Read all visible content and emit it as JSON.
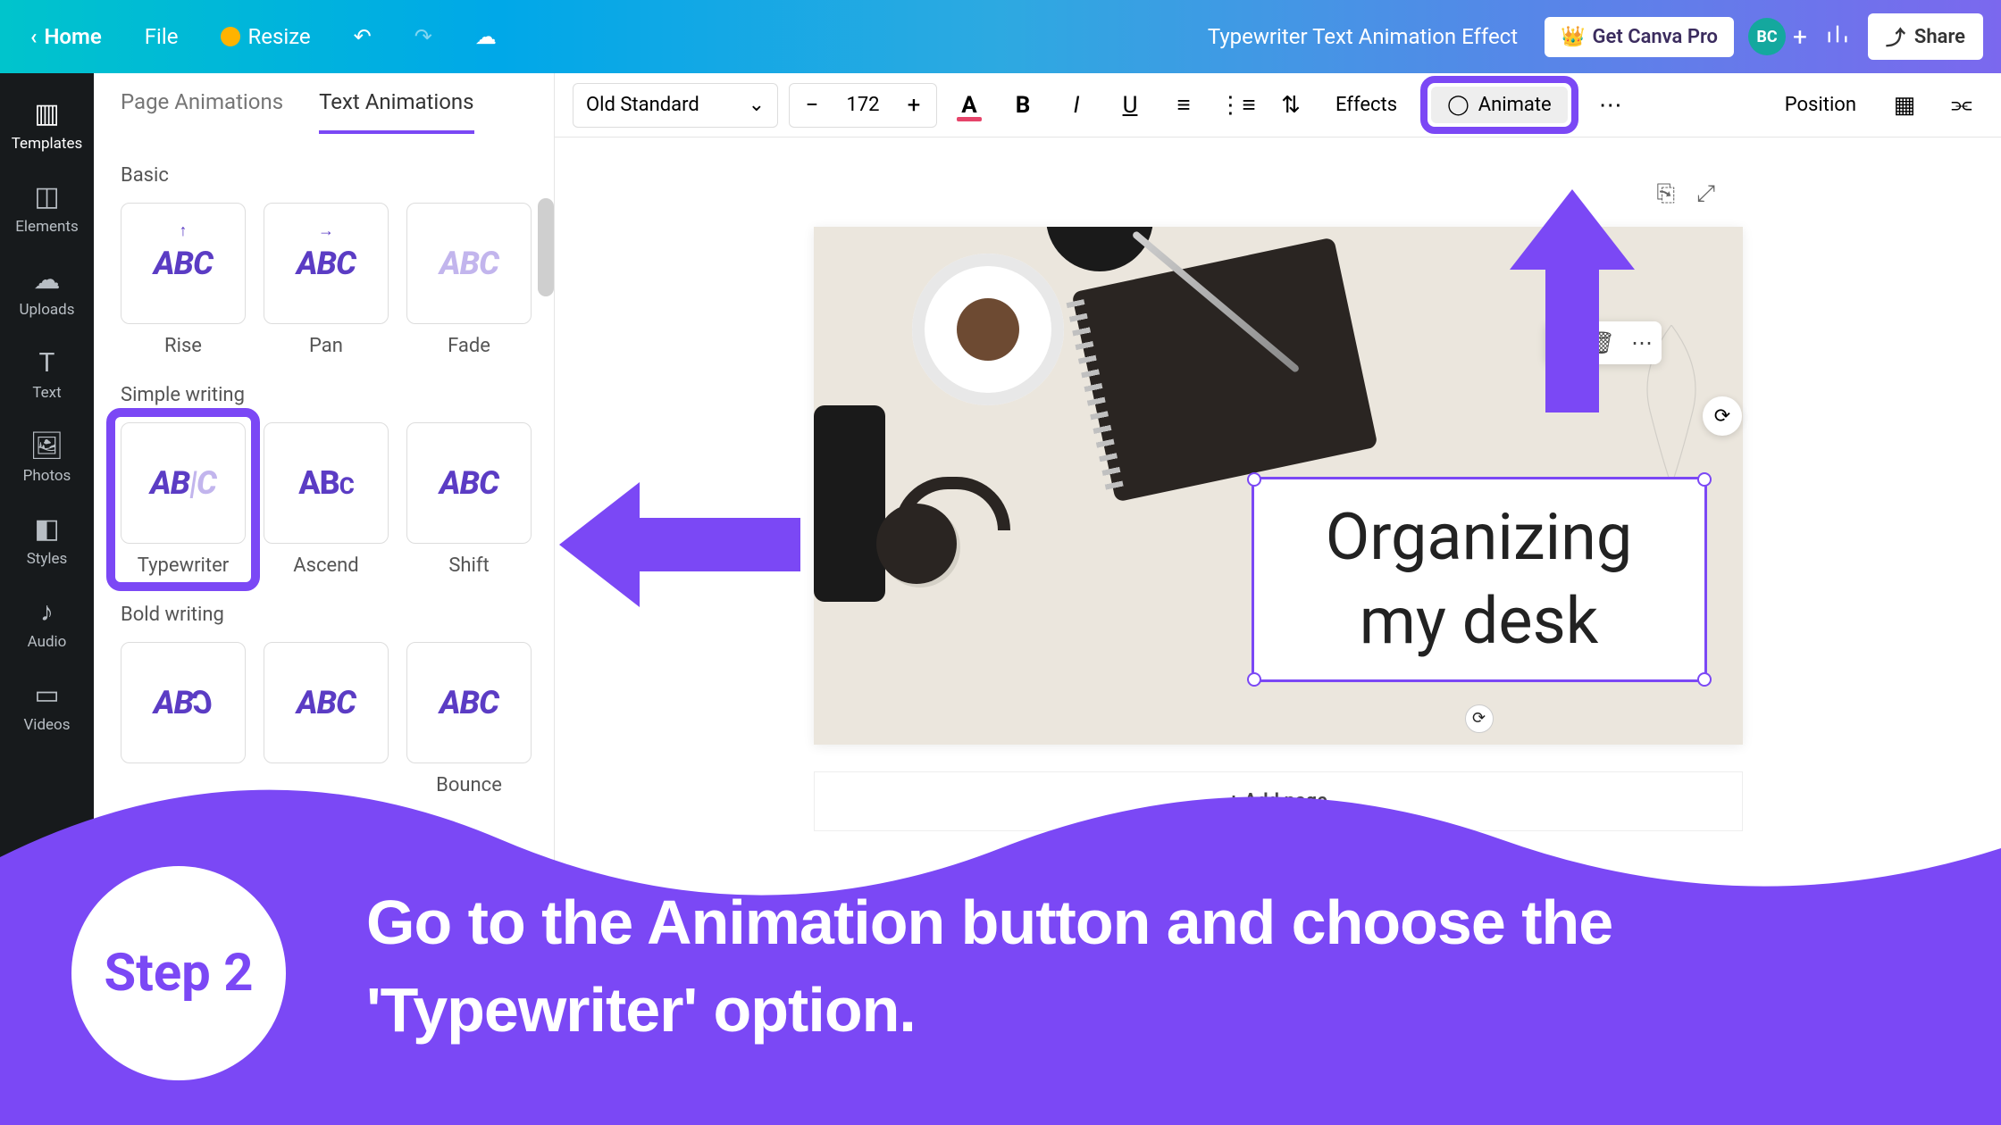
{
  "topbar": {
    "home": "Home",
    "file": "File",
    "resize": "Resize",
    "doc_title": "Typewriter Text Animation Effect",
    "get_pro": "Get Canva Pro",
    "avatar": "BC",
    "share": "Share"
  },
  "rail": {
    "templates": "Templates",
    "elements": "Elements",
    "uploads": "Uploads",
    "text": "Text",
    "photos": "Photos",
    "styles": "Styles",
    "audio": "Audio",
    "videos": "Videos"
  },
  "panel": {
    "tab_page": "Page Animations",
    "tab_text": "Text Animations",
    "section_basic": "Basic",
    "basic": {
      "rise": "Rise",
      "pan": "Pan",
      "fade": "Fade"
    },
    "section_simple": "Simple writing",
    "simple": {
      "typewriter": "Typewriter",
      "ascend": "Ascend",
      "shift": "Shift"
    },
    "section_bold": "Bold writing",
    "bold": {
      "bounce": "Bounce"
    }
  },
  "toolbar": {
    "font": "Old Standard",
    "size": "172",
    "effects": "Effects",
    "animate": "Animate",
    "position": "Position"
  },
  "canvas": {
    "text_line1": "Organizing",
    "text_line2": "my desk",
    "add_page": "+ Add page"
  },
  "tutorial": {
    "step": "Step 2",
    "text": "Go to the Animation button and choose the 'Typewriter' option."
  }
}
